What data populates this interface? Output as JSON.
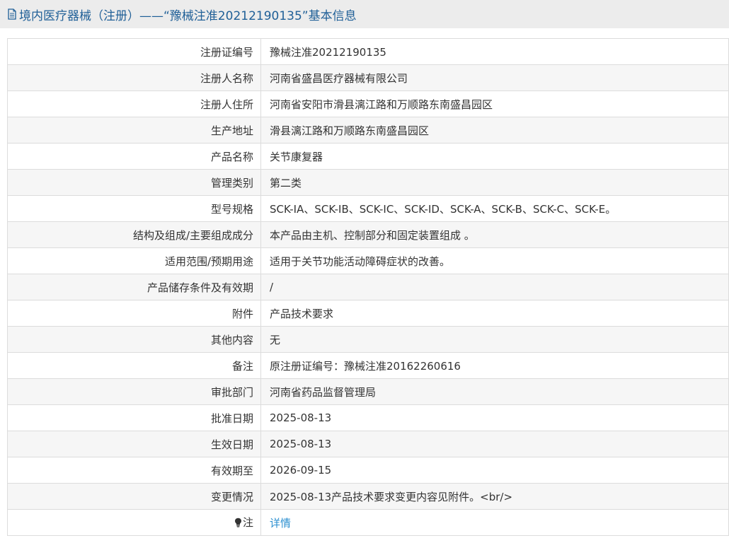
{
  "page": {
    "title": "境内医疗器械（注册）——“豫械注准20212190135”基本信息",
    "title_icon": "document-icon"
  },
  "fields": [
    {
      "label": "注册证编号",
      "value": "豫械注准20212190135"
    },
    {
      "label": "注册人名称",
      "value": "河南省盛昌医疗器械有限公司"
    },
    {
      "label": "注册人住所",
      "value": "河南省安阳市滑县漓江路和万顺路东南盛昌园区"
    },
    {
      "label": "生产地址",
      "value": "滑县漓江路和万顺路东南盛昌园区"
    },
    {
      "label": "产品名称",
      "value": "关节康复器"
    },
    {
      "label": "管理类别",
      "value": "第二类"
    },
    {
      "label": "型号规格",
      "value": "SCK-ⅠA、SCK-ⅠB、SCK-ⅠC、SCK-ⅠD、SCK-A、SCK-B、SCK-C、SCK-E。"
    },
    {
      "label": "结构及组成/主要组成成分",
      "value": "本产品由主机、控制部分和固定装置组成 。"
    },
    {
      "label": "适用范围/预期用途",
      "value": "适用于关节功能活动障碍症状的改善。"
    },
    {
      "label": "产品储存条件及有效期",
      "value": "/"
    },
    {
      "label": "附件",
      "value": "产品技术要求"
    },
    {
      "label": "其他内容",
      "value": "无"
    },
    {
      "label": "备注",
      "value": "原注册证编号：豫械注准20162260616"
    },
    {
      "label": "审批部门",
      "value": "河南省药品监督管理局"
    },
    {
      "label": "批准日期",
      "value": "2025-08-13"
    },
    {
      "label": "生效日期",
      "value": "2025-08-13"
    },
    {
      "label": "有效期至",
      "value": "2026-09-15"
    },
    {
      "label": "变更情况",
      "value": "2025-08-13产品技术要求变更内容见附件。<br/>"
    }
  ],
  "note": {
    "label": "注",
    "icon": "lightbulb-icon",
    "link_text": "详情"
  },
  "colors": {
    "title_text": "#1f5f97",
    "title_bg": "#ececec",
    "link": "#2b8fd0",
    "border": "#dcdcdc",
    "row_alt": "#f6f6f6"
  }
}
